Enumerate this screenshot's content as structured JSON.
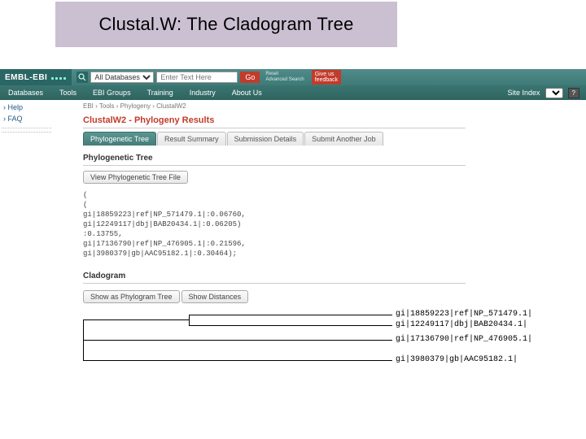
{
  "slide": {
    "title": "Clustal.W: The Cladogram Tree"
  },
  "topbar": {
    "logo": "EMBL-EBI",
    "searchScope": "All Databases",
    "searchPlaceholder": "Enter Text Here",
    "goLabel": "Go",
    "resetLabel": "Reset",
    "advancedLabel": "Advanced Search",
    "feedbackLine1": "Give us",
    "feedbackLine2": "feedback"
  },
  "nav": {
    "items": [
      "Databases",
      "Tools",
      "EBI Groups",
      "Training",
      "Industry",
      "About Us"
    ],
    "siteIndexLabel": "Site Index",
    "siteGo": "?"
  },
  "sidebar": {
    "help": "› Help",
    "faq": "› FAQ"
  },
  "crumbs": {
    "a": "EBI",
    "b": "Tools",
    "c": "Phylogeny",
    "d": "ClustalW2",
    "sep": " › "
  },
  "panel": {
    "title": "ClustalW2 - Phylogeny Results",
    "tabs": [
      "Phylogenetic Tree",
      "Result Summary",
      "Submission Details",
      "Submit Another Job"
    ],
    "phyloHeader": "Phylogenetic Tree",
    "viewFile": "View Phylogenetic Tree File",
    "newick": "(\n(\ngi|18859223|ref|NP_571479.1|:0.06760,\ngi|12249117|dbj|BAB20434.1|:0.06205)\n:0.13755,\ngi|17136790|ref|NP_476905.1|:0.21596,\ngi|3980379|gb|AAC95182.1|:0.30464);",
    "cladoHeader": "Cladogram",
    "showPhylo": "Show as Phylogram Tree",
    "showDist": "Show Distances"
  },
  "clado": {
    "labels": [
      "gi|18859223|ref|NP_571479.1|",
      "gi|12249117|dbj|BAB20434.1|",
      "gi|17136790|ref|NP_476905.1|",
      "gi|3980379|gb|AAC95182.1|"
    ]
  }
}
